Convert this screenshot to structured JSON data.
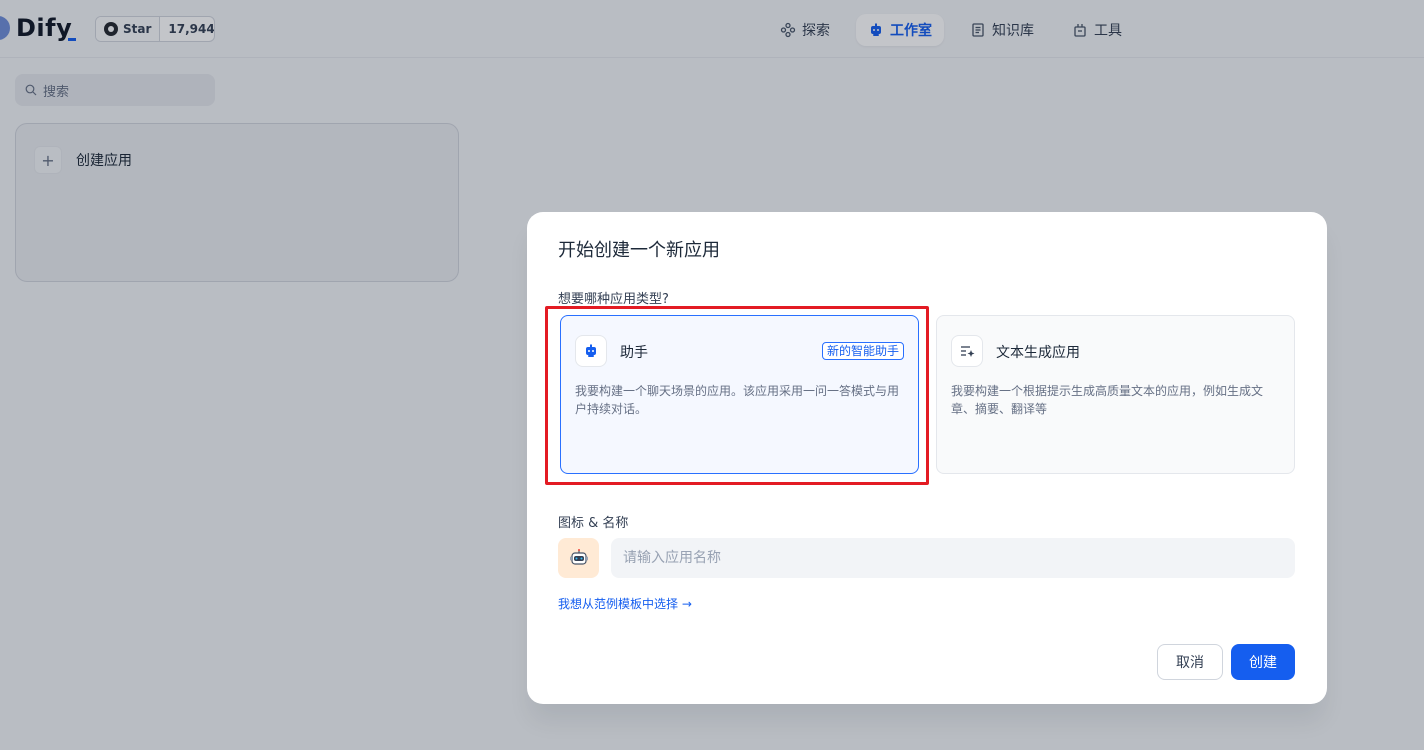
{
  "header": {
    "logo_text": "Dify",
    "github": {
      "star_label": "Star",
      "star_count": "17,944"
    },
    "nav": [
      {
        "label": "探索",
        "icon": "explore-icon"
      },
      {
        "label": "工作室",
        "icon": "robot-icon",
        "active": true
      },
      {
        "label": "知识库",
        "icon": "book-icon"
      },
      {
        "label": "工具",
        "icon": "tools-icon"
      }
    ]
  },
  "sidebar": {
    "search_placeholder": "搜索",
    "create_app_label": "创建应用"
  },
  "modal": {
    "title": "开始创建一个新应用",
    "type_question": "想要哪种应用类型?",
    "types": [
      {
        "title": "助手",
        "badge": "新的智能助手",
        "description": "我要构建一个聊天场景的应用。该应用采用一问一答模式与用户持续对话。",
        "selected": true
      },
      {
        "title": "文本生成应用",
        "description": "我要构建一个根据提示生成高质量文本的应用，例如生成文章、摘要、翻译等",
        "selected": false
      }
    ],
    "icon_name_label": "图标 & 名称",
    "name_placeholder": "请输入应用名称",
    "template_link": "我想从范例模板中选择 →",
    "cancel_label": "取消",
    "create_label": "创建"
  },
  "colors": {
    "accent": "#155eef",
    "highlight": "#e31b23",
    "avatar_bg": "#ffead5"
  }
}
